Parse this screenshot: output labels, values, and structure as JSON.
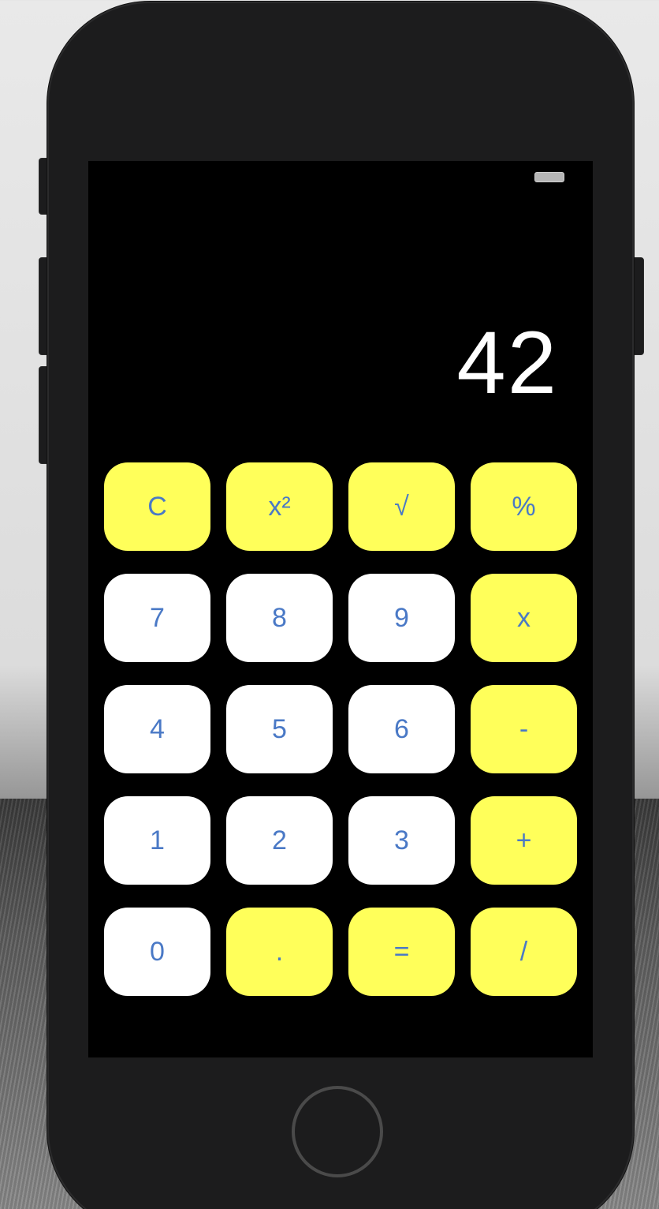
{
  "display": {
    "value": "42"
  },
  "keypad": {
    "rows": [
      [
        {
          "label": "C",
          "name": "clear-button",
          "style": "yellow"
        },
        {
          "label": "x²",
          "name": "square-button",
          "style": "yellow"
        },
        {
          "label": "√",
          "name": "sqrt-button",
          "style": "yellow"
        },
        {
          "label": "%",
          "name": "percent-button",
          "style": "yellow"
        }
      ],
      [
        {
          "label": "7",
          "name": "digit-7-button",
          "style": "white"
        },
        {
          "label": "8",
          "name": "digit-8-button",
          "style": "white"
        },
        {
          "label": "9",
          "name": "digit-9-button",
          "style": "white"
        },
        {
          "label": "x",
          "name": "multiply-button",
          "style": "yellow"
        }
      ],
      [
        {
          "label": "4",
          "name": "digit-4-button",
          "style": "white"
        },
        {
          "label": "5",
          "name": "digit-5-button",
          "style": "white"
        },
        {
          "label": "6",
          "name": "digit-6-button",
          "style": "white"
        },
        {
          "label": "-",
          "name": "subtract-button",
          "style": "yellow"
        }
      ],
      [
        {
          "label": "1",
          "name": "digit-1-button",
          "style": "white"
        },
        {
          "label": "2",
          "name": "digit-2-button",
          "style": "white"
        },
        {
          "label": "3",
          "name": "digit-3-button",
          "style": "white"
        },
        {
          "label": "+",
          "name": "add-button",
          "style": "yellow"
        }
      ],
      [
        {
          "label": "0",
          "name": "digit-0-button",
          "style": "white"
        },
        {
          "label": ".",
          "name": "decimal-button",
          "style": "yellow"
        },
        {
          "label": "=",
          "name": "equals-button",
          "style": "yellow"
        },
        {
          "label": "/",
          "name": "divide-button",
          "style": "yellow"
        }
      ]
    ]
  },
  "colors": {
    "operator_key": "#ffff5a",
    "digit_key": "#ffffff",
    "key_text": "#4a79c6",
    "screen_bg": "#000000",
    "display_text": "#ffffff"
  },
  "icons": {
    "status_bar": "battery-icon",
    "hardware": "home-button"
  }
}
